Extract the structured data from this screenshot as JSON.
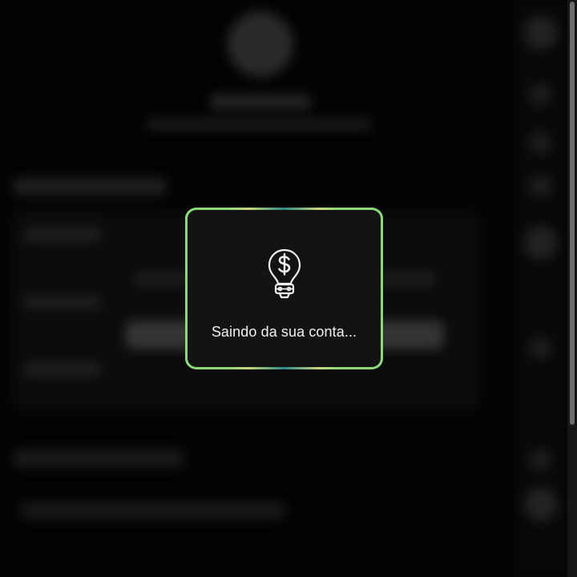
{
  "modal": {
    "icon": "lightbulb-dollar-icon",
    "message": "Saindo da sua conta..."
  },
  "colors": {
    "accent": "#8bd87a",
    "gradient_mid": "#2a8a86",
    "modal_bg": "#131313",
    "overlay_bg": "#030303"
  }
}
